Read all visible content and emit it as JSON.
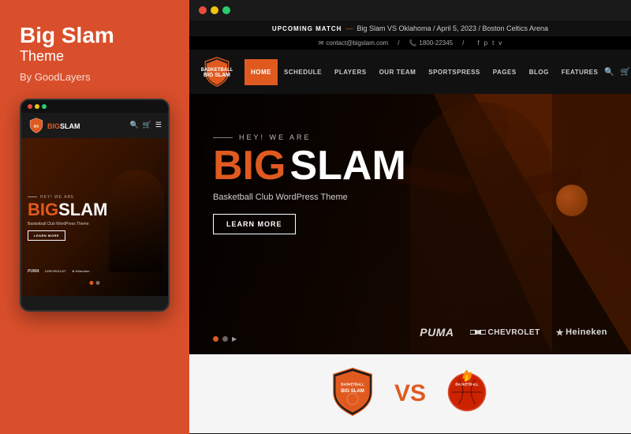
{
  "left": {
    "title": "Big Slam",
    "subtitle": "Theme",
    "by": "By GoodLayers"
  },
  "desktop": {
    "announce_bar": {
      "label": "UPCOMING MATCH",
      "dash": "—",
      "text": "Big Slam VS Oklahoma / April 5, 2023 / Boston Celtics Arena"
    },
    "contact_bar": {
      "email": "contact@bigslam.com",
      "phone": "1800-22345",
      "socials": [
        "f",
        "p",
        "t",
        "v"
      ]
    },
    "nav": {
      "brand": "BIGSLAM",
      "items": [
        {
          "label": "HOME",
          "active": true
        },
        {
          "label": "SCHEDULE",
          "active": false
        },
        {
          "label": "PLAYERS",
          "active": false
        },
        {
          "label": "OUR TEAM",
          "active": false
        },
        {
          "label": "SPORTSPRESS",
          "active": false
        },
        {
          "label": "PAGES",
          "active": false
        },
        {
          "label": "BLOG",
          "active": false
        },
        {
          "label": "FEATURES",
          "active": false
        }
      ]
    },
    "hero": {
      "hey": "HEY! WE ARE",
      "big": "BIG",
      "slam": "SLAM",
      "tagline": "Basketball Club WordPress Theme",
      "learn_btn": "LEARN MORE"
    },
    "sponsors": [
      {
        "name": "PUMA",
        "style": "puma"
      },
      {
        "name": "CHEVROLET",
        "style": "chevrolet"
      },
      {
        "name": "Heineken",
        "style": "heineken"
      }
    ],
    "vs_section": {
      "vs_text": "VS"
    }
  },
  "mobile": {
    "brand_big": "BIG",
    "brand_slam": "SLAM",
    "hey": "HEY! WE ARE",
    "big": "BIG",
    "slam": "SLAM",
    "tagline": "Basketball Club WordPress Theme",
    "learn_btn": "LEARN MORE",
    "sponsors": [
      "PUMA",
      "CHEVROLET",
      "★ Heineken"
    ]
  },
  "colors": {
    "orange": "#e05a20",
    "dark": "#111111",
    "bg_red": "#d94f2b"
  }
}
